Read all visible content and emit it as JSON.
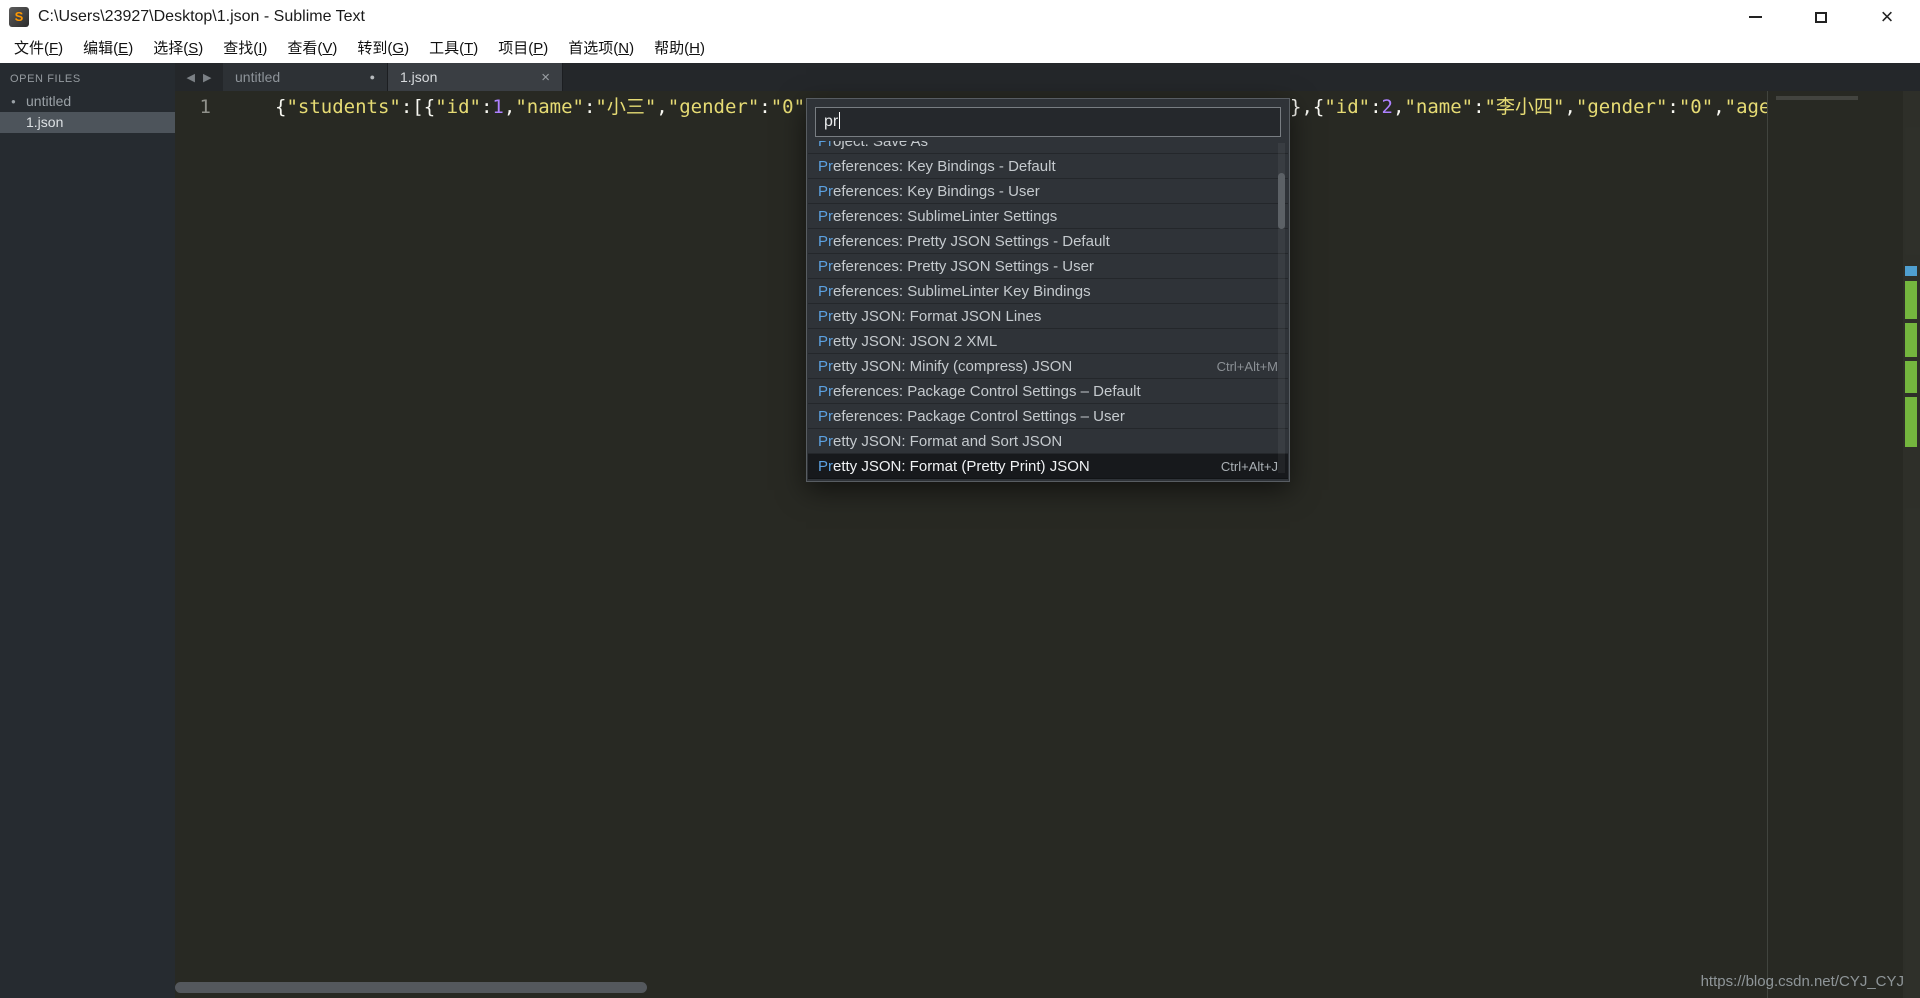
{
  "window": {
    "title": "C:\\Users\\23927\\Desktop\\1.json - Sublime Text",
    "app_icon_letter": "S",
    "controls": {
      "close_glyph": "×"
    }
  },
  "menu": {
    "items": [
      {
        "label": "文件",
        "key": "F"
      },
      {
        "label": "编辑",
        "key": "E"
      },
      {
        "label": "选择",
        "key": "S"
      },
      {
        "label": "查找",
        "key": "I"
      },
      {
        "label": "查看",
        "key": "V"
      },
      {
        "label": "转到",
        "key": "G"
      },
      {
        "label": "工具",
        "key": "T"
      },
      {
        "label": "项目",
        "key": "P"
      },
      {
        "label": "首选项",
        "key": "N"
      },
      {
        "label": "帮助",
        "key": "H"
      }
    ]
  },
  "sidebar": {
    "header": "OPEN FILES",
    "files": [
      {
        "name": "untitled",
        "modified": true,
        "selected": false
      },
      {
        "name": "1.json",
        "modified": false,
        "selected": true
      }
    ]
  },
  "tabs": {
    "back_glyph": "◀",
    "forward_glyph": "▶",
    "items": [
      {
        "label": "untitled",
        "modified": true,
        "active": false
      },
      {
        "label": "1.json",
        "modified": false,
        "active": true
      }
    ],
    "modified_dot_glyph": "●",
    "close_glyph": "×"
  },
  "editor": {
    "line_number": "1",
    "code_left": [
      {
        "text": "{",
        "type": "punct"
      },
      {
        "text": "\"students\"",
        "type": "string"
      },
      {
        "text": ":",
        "type": "punct"
      },
      {
        "text": "[{",
        "type": "punct"
      },
      {
        "text": "\"id\"",
        "type": "string"
      },
      {
        "text": ":",
        "type": "punct"
      },
      {
        "text": "1",
        "type": "number"
      },
      {
        "text": ",",
        "type": "punct"
      },
      {
        "text": "\"name\"",
        "type": "string"
      },
      {
        "text": ":",
        "type": "punct"
      },
      {
        "text": "\"小三\"",
        "type": "string"
      },
      {
        "text": ",",
        "type": "punct"
      },
      {
        "text": "\"gender\"",
        "type": "string"
      },
      {
        "text": ":",
        "type": "punct"
      },
      {
        "text": "\"0\"",
        "type": "string"
      },
      {
        "text": ",",
        "type": "punct"
      }
    ],
    "code_right": [
      {
        "text": "},{",
        "type": "punct"
      },
      {
        "text": "\"id\"",
        "type": "string"
      },
      {
        "text": ":",
        "type": "punct"
      },
      {
        "text": "2",
        "type": "number"
      },
      {
        "text": ",",
        "type": "punct"
      },
      {
        "text": "\"name\"",
        "type": "string"
      },
      {
        "text": ":",
        "type": "punct"
      },
      {
        "text": "\"李小四\"",
        "type": "string"
      },
      {
        "text": ",",
        "type": "punct"
      },
      {
        "text": "\"gender\"",
        "type": "string"
      },
      {
        "text": ":",
        "type": "punct"
      },
      {
        "text": "\"0\"",
        "type": "string"
      },
      {
        "text": ",",
        "type": "punct"
      },
      {
        "text": "\"age\"",
        "type": "string"
      }
    ]
  },
  "palette": {
    "query": "pr",
    "items": [
      {
        "hl": "Pr",
        "rest": "oject: Save As",
        "shortcut": "",
        "selected": false
      },
      {
        "hl": "Pr",
        "rest": "eferences: Key Bindings - Default",
        "shortcut": "",
        "selected": false
      },
      {
        "hl": "Pr",
        "rest": "eferences: Key Bindings - User",
        "shortcut": "",
        "selected": false
      },
      {
        "hl": "Pr",
        "rest": "eferences: SublimeLinter Settings",
        "shortcut": "",
        "selected": false
      },
      {
        "hl": "Pr",
        "rest": "eferences: Pretty JSON Settings - Default",
        "shortcut": "",
        "selected": false
      },
      {
        "hl": "Pr",
        "rest": "eferences: Pretty JSON Settings - User",
        "shortcut": "",
        "selected": false
      },
      {
        "hl": "Pr",
        "rest": "eferences: SublimeLinter Key Bindings",
        "shortcut": "",
        "selected": false
      },
      {
        "hl": "Pr",
        "rest": "etty JSON: Format JSON Lines",
        "shortcut": "",
        "selected": false
      },
      {
        "hl": "Pr",
        "rest": "etty JSON: JSON 2 XML",
        "shortcut": "",
        "selected": false
      },
      {
        "hl": "Pr",
        "rest": "etty JSON: Minify (compress) JSON",
        "shortcut": "Ctrl+Alt+M",
        "selected": false
      },
      {
        "hl": "Pr",
        "rest": "eferences: Package Control Settings – Default",
        "shortcut": "",
        "selected": false
      },
      {
        "hl": "Pr",
        "rest": "eferences: Package Control Settings – User",
        "shortcut": "",
        "selected": false
      },
      {
        "hl": "Pr",
        "rest": "etty JSON: Format and Sort JSON",
        "shortcut": "",
        "selected": false
      },
      {
        "hl": "Pr",
        "rest": "etty JSON: Format (Pretty Print) JSON",
        "shortcut": "Ctrl+Alt+J",
        "selected": true
      }
    ]
  },
  "colors": {
    "string": "#e6db74",
    "number": "#ae81ff",
    "punctuation": "#f8f8f2",
    "match_highlight": "#5ba0e0",
    "editor_bg": "#282923",
    "palette_bg": "#2f3338",
    "selected_row_bg": "#17191c",
    "gutter_mark_green": "#74b63e"
  },
  "watermark": "https://blog.csdn.net/CYJ_CYJ"
}
